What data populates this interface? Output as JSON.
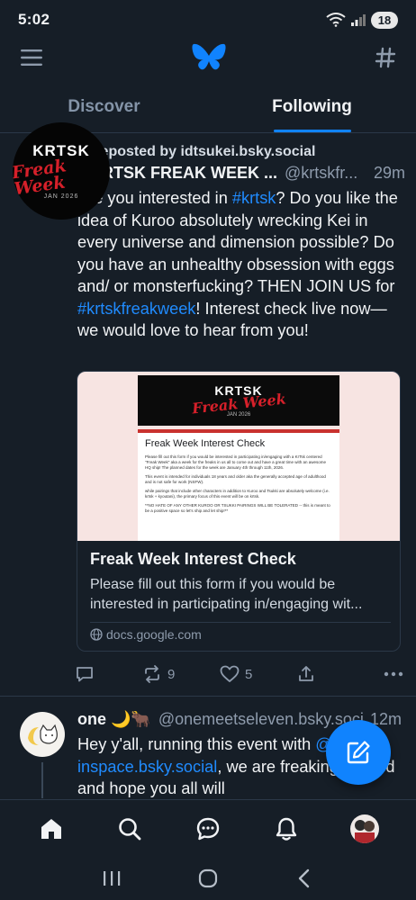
{
  "status_bar": {
    "time": "5:02",
    "battery": "18"
  },
  "tabs": [
    {
      "label": "Discover",
      "active": false
    },
    {
      "label": "Following",
      "active": true
    }
  ],
  "post1": {
    "avatar": {
      "line1": "KRTSK",
      "line2": "Freak Week",
      "line3": "JAN 2026"
    },
    "repost_text": "Reposted by idtsukei.bsky.social",
    "author_name": "KRTSK FREAK WEEK ...",
    "handle": "@krtskfr...",
    "time": "29m",
    "text": {
      "t1": "Are you interested in ",
      "tag1": "#krtsk",
      "t2": "? Do you like the idea of Kuroo absolutely wrecking Kei in every universe and dimension possible? Do you have an unhealthy obsession with eggs and/ or monsterfucking? THEN JOIN US for ",
      "tag2": "#krtskfreakweek",
      "t3": "! Interest check live now—we would love to hear from you!"
    },
    "embed": {
      "image": {
        "header_line1": "KRTSK",
        "header_line2": "Freak Week",
        "header_line3": "JAN 2026",
        "doc_title": "Freak Week Interest Check",
        "doc_p1": "Please fill out this form if you would be interested in participating in/engaging with a KrTsk centered \"Freak Week\" aka a week for the freaks in us all to come out and have a great time with an awesome HQ ship! The planned dates for the week are January 4th through 11th, 2026.",
        "doc_p2": "This event is intended for individuals 18 years and older aka the generally accepted age of adulthood and is not safe for work (NSFW).",
        "doc_p3": "while pairings that include other characters in addition to Kuroo and Tsukki are absolutely welcome (i.e. krtsk + kyoutani), the primary focus of this event will be on krtsk.",
        "doc_p4": "**NO HATE OF ANY OTHER KUROO OR TSUKKI PAIRINGS WILL BE TOLERATED -- this is meant to be a positive space so let's ship and let ship!**"
      },
      "title": "Freak Week Interest Check",
      "description": "Please fill out this form if you would be interested in participating in/engaging wit...",
      "domain": "docs.google.com"
    },
    "actions": {
      "reposts": "9",
      "likes": "5"
    }
  },
  "post2": {
    "author_name": "one 🌙🐂",
    "handle": "@onemeetseleven.bsky.social",
    "time": "12m",
    "text": {
      "t1": "Hey y'all, running this event with ",
      "mention": "@ro-inspace.bsky.social",
      "t2": ", we are freaking excited and hope you all will"
    }
  },
  "colors": {
    "accent": "#1083fe",
    "link": "#208bfe",
    "background": "#161e27"
  }
}
